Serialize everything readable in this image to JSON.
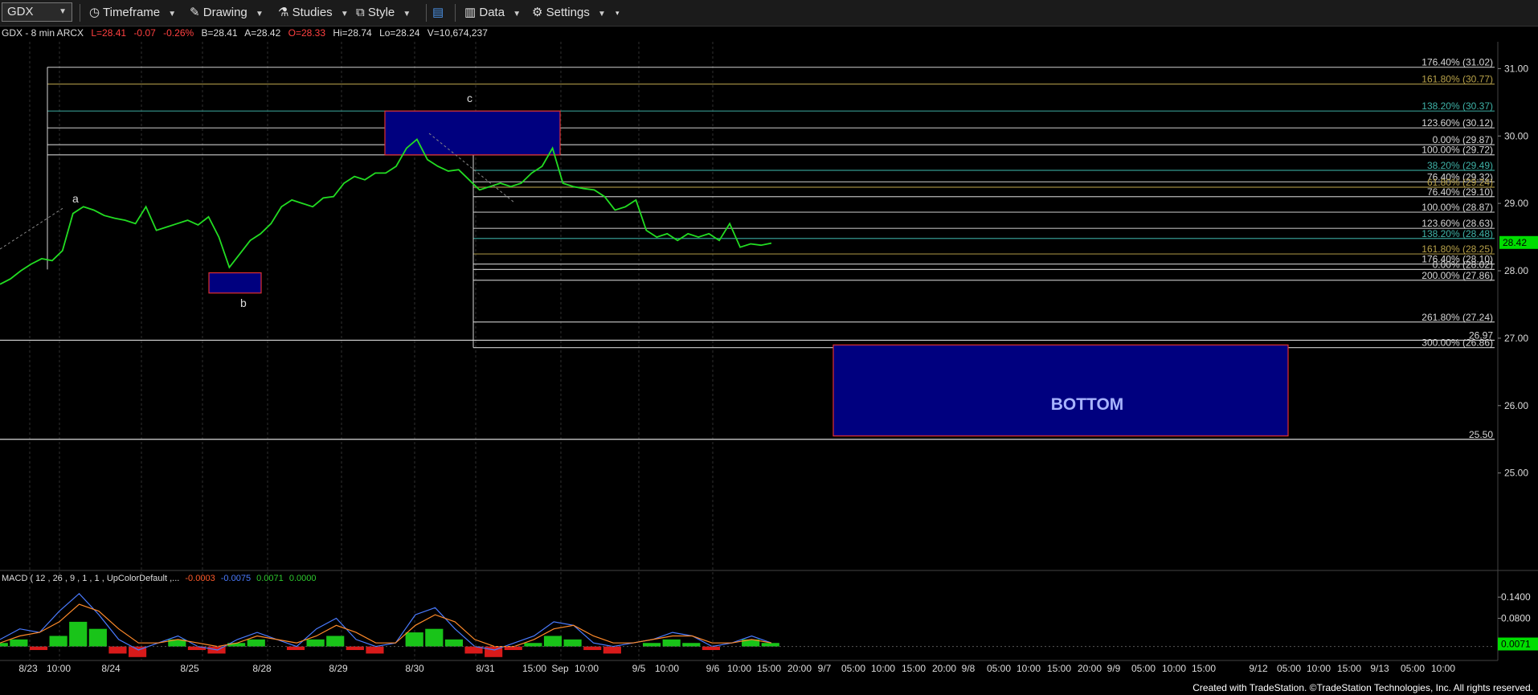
{
  "toolbar": {
    "symbol": "GDX",
    "timeframe": "Timeframe",
    "drawing": "Drawing",
    "studies": "Studies",
    "style": "Style",
    "data": "Data",
    "settings": "Settings"
  },
  "header": {
    "title": "GDX - 8 min  ARCX",
    "last": "L=28.41",
    "change": "-0.07",
    "change_pct": "-0.26%",
    "bid": "B=28.41",
    "ask": "A=28.42",
    "open": "O=28.33",
    "high": "Hi=28.74",
    "low": "Lo=28.24",
    "volume": "V=10,674,237"
  },
  "colors": {
    "price": "#22dd22",
    "bid_ask": "#dddddd",
    "change": "#ff4040",
    "fib_white": "#d8d8d8",
    "fib_gold": "#b8a24a",
    "fib_teal": "#3fb3a8",
    "box_fill": "#00007f",
    "box_border": "#e23030",
    "bottom_text": "#a8b4ff",
    "last_price_tag": "#00dd00"
  },
  "footer": "Created with TradeStation. ©TradeStation Technologies, Inc. All rights reserved.",
  "annotations": {
    "a": "a",
    "b": "b",
    "c": "c",
    "bottom": "BOTTOM"
  },
  "chart_data": [
    {
      "type": "line",
      "title": "GDX - 8 min ARCX",
      "ylim": [
        24.15,
        31.35
      ],
      "y_ticks": [
        "31.00",
        "30.00",
        "29.00",
        "28.00",
        "27.00",
        "26.00",
        "25.00"
      ],
      "y_tick_values": [
        31,
        30,
        29,
        28,
        27,
        26,
        25
      ],
      "last_price": 28.42,
      "last_price_label": "28.42",
      "x_labels": [
        "8/23",
        "10:00",
        "8/24",
        "8/25",
        "8/28",
        "8/29",
        "8/30",
        "8/31",
        "15:00",
        "Sep",
        "10:00",
        "9/5",
        "10:00",
        "9/6",
        "10:00",
        "15:00",
        "20:00",
        "9/7",
        "05:00",
        "10:00",
        "15:00",
        "20:00",
        "9/8",
        "05:00",
        "10:00",
        "15:00",
        "20:00",
        "9/9",
        "05:00",
        "10:00",
        "15:00",
        "9/12",
        "05:00",
        "10:00",
        "15:00",
        "9/13",
        "05:00",
        "10:00"
      ],
      "series": [
        {
          "values": [
            27.8,
            27.88,
            28.0,
            28.1,
            28.18,
            28.15,
            28.3,
            28.85,
            28.95,
            28.9,
            28.82,
            28.78,
            28.75,
            28.7,
            28.95,
            28.6,
            28.65,
            28.7,
            28.75,
            28.68,
            28.8,
            28.5,
            28.05,
            28.25,
            28.45,
            28.55,
            28.7,
            28.95,
            29.05,
            29.0,
            28.95,
            29.08,
            29.1,
            29.3,
            29.4,
            29.35,
            29.45,
            29.45,
            29.55,
            29.82,
            29.95,
            29.65,
            29.55,
            29.48,
            29.5,
            29.35,
            29.2,
            29.25,
            29.3,
            29.25,
            29.3,
            29.45,
            29.55,
            29.82,
            29.3,
            29.25,
            29.22,
            29.2,
            29.1,
            28.9,
            28.95,
            29.05,
            28.6,
            28.5,
            28.55,
            28.45,
            28.55,
            28.5,
            28.55,
            28.45,
            28.7,
            28.35,
            28.4,
            28.38,
            28.41
          ]
        }
      ],
      "fib_levels": [
        {
          "label": "176.40% (31.02)",
          "value": 31.02,
          "color": "white"
        },
        {
          "label": "161.80% (30.77)",
          "value": 30.77,
          "color": "gold"
        },
        {
          "label": "138.20% (30.37)",
          "value": 30.37,
          "color": "teal"
        },
        {
          "label": "123.60% (30.12)",
          "value": 30.12,
          "color": "white"
        },
        {
          "label": "0.00% (29.87)",
          "value": 29.87,
          "color": "white"
        },
        {
          "label": "100.00% (29.72)",
          "value": 29.72,
          "color": "white"
        },
        {
          "label": "38.20% (29.49)",
          "value": 29.49,
          "color": "teal"
        },
        {
          "label": "76.40% (29.32)",
          "value": 29.32,
          "color": "white"
        },
        {
          "label": "61.80% (29.24)",
          "value": 29.24,
          "color": "gold"
        },
        {
          "label": "76.40% (29.10)",
          "value": 29.1,
          "color": "white"
        },
        {
          "label": "100.00% (28.87)",
          "value": 28.87,
          "color": "white"
        },
        {
          "label": "123.60% (28.63)",
          "value": 28.63,
          "color": "white"
        },
        {
          "label": "138.20% (28.48)",
          "value": 28.48,
          "color": "teal"
        },
        {
          "label": "161.80% (28.25)",
          "value": 28.25,
          "color": "gold"
        },
        {
          "label": "176.40% (28.10)",
          "value": 28.1,
          "color": "white"
        },
        {
          "label": "0.00% (28.02)",
          "value": 28.02,
          "color": "white"
        },
        {
          "label": "200.00% (27.86)",
          "value": 27.86,
          "color": "white"
        },
        {
          "label": "261.80% (27.24)",
          "value": 27.24,
          "color": "white"
        },
        {
          "label": "300.00% (26.86)",
          "value": 26.86,
          "color": "white"
        }
      ],
      "horizontal_levels": [
        {
          "label": "26.97",
          "value": 26.97
        },
        {
          "label": "25.50",
          "value": 25.5
        }
      ],
      "zones": [
        {
          "name": "c",
          "y_top": 30.37,
          "y_bottom": 29.72
        },
        {
          "name": "b",
          "y_top": 27.97,
          "y_bottom": 27.67
        },
        {
          "name": "BOTTOM",
          "y_top": 26.9,
          "y_bottom": 25.55
        }
      ]
    },
    {
      "type": "area",
      "title": "MACD ( 12 , 26 , 9 , 1 , 1 , UpColorDefault ,...",
      "params": "MACD ( 12 , 26 , 9 , 1 , 1 , UpColorDefault ,...",
      "readings": [
        "-0.0003",
        "-0.0075",
        "0.0071",
        "0.0000"
      ],
      "reading_colors": [
        "#ff5a2a",
        "#4a7bff",
        "#2ec82e",
        "#2ec82e"
      ],
      "ylim": [
        -0.035,
        0.17
      ],
      "y_ticks": [
        "0.1400",
        "0.0800"
      ],
      "y_tick_values": [
        0.14,
        0.08
      ],
      "last_value_label": "0.0071",
      "histogram": [
        0.01,
        0.02,
        -0.01,
        0.03,
        0.07,
        0.05,
        -0.02,
        -0.03,
        0.0,
        0.02,
        -0.01,
        -0.02,
        0.01,
        0.02,
        0.0,
        -0.01,
        0.02,
        0.03,
        -0.01,
        -0.02,
        0.0,
        0.04,
        0.05,
        0.02,
        -0.02,
        -0.03,
        -0.01,
        0.01,
        0.03,
        0.02,
        -0.01,
        -0.02,
        0.0,
        0.01,
        0.02,
        0.01,
        -0.01,
        0.0,
        0.02,
        0.01
      ],
      "macd": [
        0.02,
        0.05,
        0.04,
        0.1,
        0.15,
        0.09,
        0.02,
        -0.01,
        0.01,
        0.03,
        0.0,
        -0.01,
        0.02,
        0.04,
        0.02,
        0.0,
        0.05,
        0.08,
        0.02,
        0.0,
        0.01,
        0.09,
        0.11,
        0.05,
        0.0,
        -0.01,
        0.01,
        0.03,
        0.07,
        0.06,
        0.01,
        0.0,
        0.01,
        0.02,
        0.04,
        0.03,
        0.0,
        0.01,
        0.03,
        0.01
      ],
      "signal": [
        0.01,
        0.03,
        0.04,
        0.07,
        0.12,
        0.1,
        0.05,
        0.01,
        0.01,
        0.02,
        0.01,
        0.0,
        0.01,
        0.03,
        0.02,
        0.01,
        0.03,
        0.06,
        0.04,
        0.01,
        0.01,
        0.06,
        0.09,
        0.07,
        0.02,
        0.0,
        0.0,
        0.02,
        0.05,
        0.06,
        0.03,
        0.01,
        0.01,
        0.02,
        0.03,
        0.03,
        0.01,
        0.01,
        0.02,
        0.01
      ]
    }
  ]
}
